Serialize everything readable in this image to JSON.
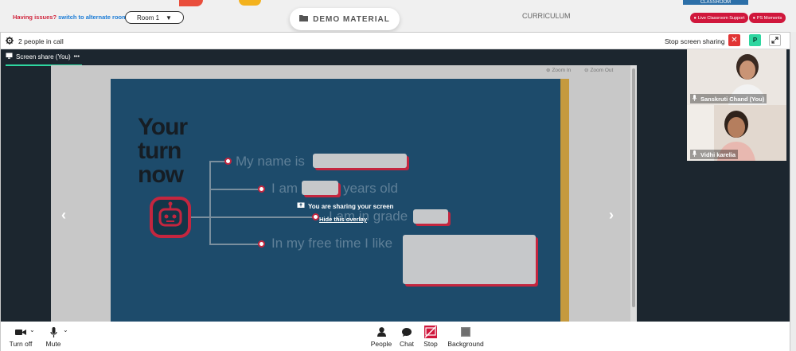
{
  "topbar": {
    "issues_label": "Having issues?",
    "alternate_link": "switch to alternate room",
    "room_value": "Room 1",
    "demo_label": "DEMO MATERIAL",
    "curriculum_label": "CURRICULUM",
    "classroom_tab": "CLASSROOM",
    "support_label": "Live Classroom Support",
    "moments_label": "PS Moments"
  },
  "callbar": {
    "people_count": "2 people in call",
    "stop_sharing_label": "Stop screen sharing",
    "close_symbol": "✕",
    "p_badge": "P"
  },
  "share": {
    "tab_label": "Screen share (You)",
    "more_symbol": "•••",
    "zoom_in": "Zoom In",
    "zoom_out": "Zoom Out",
    "overlay_message": "You are sharing your screen",
    "overlay_link": "Hide this overlay"
  },
  "slide": {
    "heading_lines": [
      "Your",
      "turn",
      "now"
    ],
    "prompts": [
      "My name is",
      "I am",
      "years old",
      "I am in grade",
      "In my free time I like"
    ]
  },
  "participants": [
    {
      "name": "Sanskruti Chand (You)"
    },
    {
      "name": "Vidhi karelia"
    }
  ],
  "controls": {
    "camera": "Turn off",
    "mic": "Mute",
    "people": "People",
    "chat": "Chat",
    "stop": "Stop",
    "background": "Background"
  },
  "colors": {
    "brand_red": "#d0173c",
    "accent_green": "#2ed6a0",
    "slide_blue": "#1d4b6b",
    "link_blue": "#1a7bd6"
  }
}
